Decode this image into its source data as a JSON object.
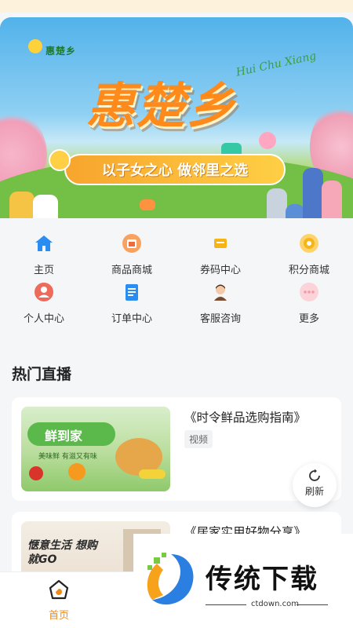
{
  "banner": {
    "logo_text": "惠楚乡",
    "pinyin": "Hui Chu Xiang",
    "title": "惠楚乡",
    "slogan": "以子女之心 做邻里之选"
  },
  "grid": {
    "items": [
      {
        "label": "主页",
        "icon": "home-icon",
        "color": "#2b8cf2"
      },
      {
        "label": "商品商城",
        "icon": "shop-icon",
        "color": "#f06a3c"
      },
      {
        "label": "券码中心",
        "icon": "coupon-icon",
        "color": "#f7b515"
      },
      {
        "label": "积分商城",
        "icon": "points-icon",
        "color": "#f7b515"
      },
      {
        "label": "个人中心",
        "icon": "user-icon",
        "color": "#ee6a5b"
      },
      {
        "label": "订单中心",
        "icon": "order-icon",
        "color": "#2b8cf2"
      },
      {
        "label": "客服咨询",
        "icon": "support-icon",
        "color": "#7a4a30"
      },
      {
        "label": "更多",
        "icon": "more-icon",
        "color": "#f59aa6"
      }
    ]
  },
  "section": {
    "title": "热门直播"
  },
  "cards": [
    {
      "title": "《时令鲜品选购指南》",
      "tag": "视频",
      "thumb_text": "鲜到家",
      "thumb_sub": "美味鲜 有滋又有味"
    },
    {
      "title": "《居家实用好物分享》",
      "thumb_text": "惬意生活 想购就GO"
    }
  ],
  "refresh": {
    "label": "刷新"
  },
  "tabbar": {
    "home_label": "首页"
  },
  "watermark": {
    "text": "传统下载",
    "sub": "ctdown.com"
  },
  "colors": {
    "accent": "#f08a1a",
    "background": "#f5f6f8"
  }
}
